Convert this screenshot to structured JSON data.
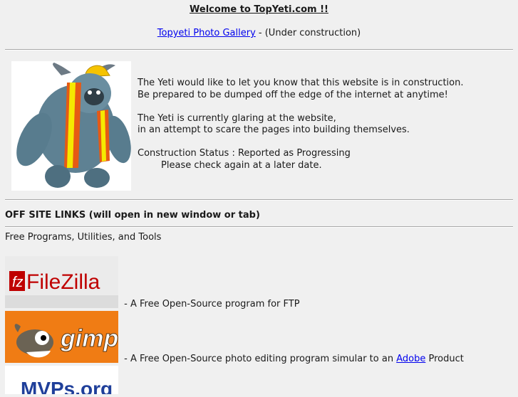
{
  "header": {
    "title": "Welcome to TopYeti.com !!",
    "gallery_link": "Topyeti Photo Gallery",
    "gallery_suffix": " - (Under construction)"
  },
  "intro": {
    "lines": [
      "The Yeti would like to let you know that this website is in construction.",
      "Be prepared to be dumped off the edge of the internet at anytime!",
      "",
      "The Yeti is currently glaring at the website,",
      "in an attempt to scare the pages into building themselves.",
      "",
      "Construction Status : Reported as Progressing",
      "        Please check again at a later date."
    ]
  },
  "offsite": {
    "heading": "OFF SITE LINKS (will open in new window or tab)",
    "section_title": "Free Programs, Utilities, and Tools",
    "links": [
      {
        "logo_text": "FileZilla",
        "desc": " - A Free Open-Source program for FTP"
      },
      {
        "logo_text": "gimp",
        "desc_prefix": " - A Free Open-Source photo editing program simular to an ",
        "link_text": "Adobe",
        "desc_suffix": " Product"
      },
      {
        "logo_text": "MVPs.org"
      }
    ]
  },
  "colors": {
    "background": "#f0f0f0",
    "link": "#0000ee",
    "filezilla_red": "#bf0000",
    "gimp_orange": "#f07c14"
  }
}
